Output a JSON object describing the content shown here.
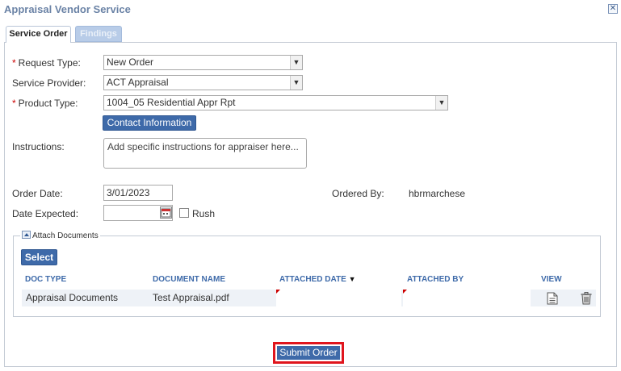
{
  "window": {
    "title": "Appraisal Vendor Service"
  },
  "tabs": [
    {
      "label": "Service Order",
      "active": true
    },
    {
      "label": "Findings",
      "active": false
    }
  ],
  "form": {
    "request_type": {
      "label": "Request Type:",
      "required": "*",
      "value": "New Order"
    },
    "service_provider": {
      "label": "Service Provider:",
      "value": "ACT Appraisal"
    },
    "product_type": {
      "label": "Product Type:",
      "required": "*",
      "value": "1004_05 Residential Appr Rpt"
    },
    "contact_button": "Contact Information",
    "instructions": {
      "label": "Instructions:",
      "placeholder": "Add specific instructions for appraiser here..."
    },
    "order_date": {
      "label": "Order Date:",
      "value": "3/01/2023"
    },
    "ordered_by": {
      "label": "Ordered By:",
      "value": "hbrmarchese"
    },
    "date_expected": {
      "label": "Date Expected:",
      "value": ""
    },
    "rush": {
      "label": "Rush",
      "checked": false
    }
  },
  "attach": {
    "legend": "Attach Documents",
    "select_button": "Select",
    "columns": [
      "DOC TYPE",
      "DOCUMENT NAME",
      "ATTACHED DATE",
      "ATTACHED BY",
      "VIEW"
    ],
    "sort_indicator": "▼",
    "rows": [
      {
        "doc_type": "Appraisal Documents",
        "document_name": "Test Appraisal.pdf",
        "attached_date": "",
        "attached_by": ""
      }
    ]
  },
  "submit_button": "Submit Order",
  "colors": {
    "accent": "#3e6aa9",
    "highlight": "#e0151d",
    "required": "#cc0000"
  },
  "icons": [
    "close-icon",
    "chevron-down-icon",
    "calendar-icon",
    "collapse-icon",
    "document-icon",
    "trash-icon"
  ]
}
